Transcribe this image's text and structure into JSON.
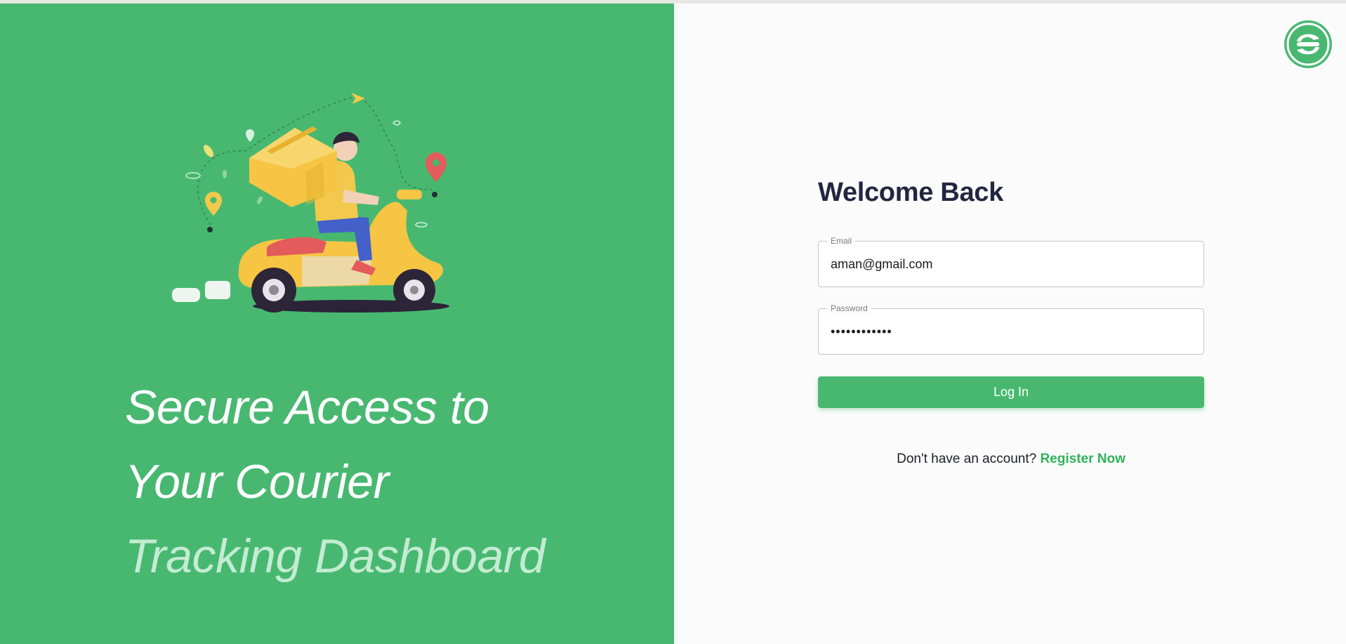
{
  "hero": {
    "tagline_line1": "Secure Access to",
    "tagline_line2": "Your Courier",
    "tagline_line3": "Tracking Dashboard"
  },
  "login": {
    "title": "Welcome Back",
    "email_label": "Email",
    "email_value": "aman@gmail.com",
    "password_label": "Password",
    "password_value": "aman@1234567",
    "button_label": "Log In",
    "register_prompt": "Don't have an account?",
    "register_link": "Register Now"
  },
  "icons": {
    "logo": "brand-logo-icon",
    "illustration": "courier-scooter-illustration"
  },
  "colors": {
    "brand_green": "#48b871",
    "title_dark": "#222640",
    "link_green": "#2fb35a"
  }
}
